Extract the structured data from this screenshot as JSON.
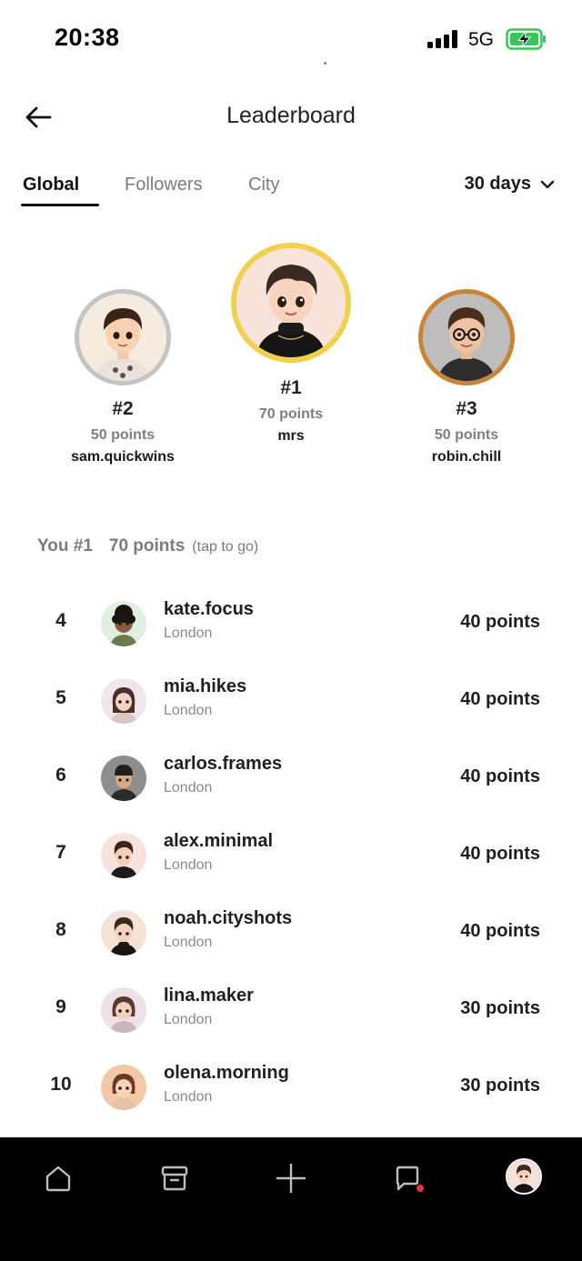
{
  "status_bar": {
    "time": "20:38",
    "network": "5G",
    "battery_state": "charging",
    "battery_color": "#34c759"
  },
  "header": {
    "title": "Leaderboard",
    "back_icon": "arrow-left-icon"
  },
  "tabs": [
    {
      "label": "Global",
      "active": true
    },
    {
      "label": "Followers",
      "active": false
    },
    {
      "label": "City",
      "active": false
    }
  ],
  "period": {
    "selected": "30 days",
    "icon": "chevron-down-icon"
  },
  "podium": {
    "first": {
      "rank": "#1",
      "points": "70 points",
      "username": "mrs",
      "ring_color": "#f3cf4f"
    },
    "second": {
      "rank": "#2",
      "points": "50 points",
      "username": "sam.quickwins",
      "ring_color": "#c4c4c4"
    },
    "third": {
      "rank": "#3",
      "points": "50 points",
      "username": "robin.chill",
      "ring_color": "#c98436"
    }
  },
  "you": {
    "rank": "You #1",
    "points": "70 points",
    "hint": "(tap to go)"
  },
  "leaderboard": [
    {
      "rank": "4",
      "username": "kate.focus",
      "city": "London",
      "points": "40 points"
    },
    {
      "rank": "5",
      "username": "mia.hikes",
      "city": "London",
      "points": "40 points"
    },
    {
      "rank": "6",
      "username": "carlos.frames",
      "city": "London",
      "points": "40 points"
    },
    {
      "rank": "7",
      "username": "alex.minimal",
      "city": "London",
      "points": "40 points"
    },
    {
      "rank": "8",
      "username": "noah.cityshots",
      "city": "London",
      "points": "40 points"
    },
    {
      "rank": "9",
      "username": "lina.maker",
      "city": "London",
      "points": "30 points"
    },
    {
      "rank": "10",
      "username": "olena.morning",
      "city": "London",
      "points": "30 points"
    }
  ],
  "bottom_nav": [
    {
      "name": "home-icon"
    },
    {
      "name": "archive-icon"
    },
    {
      "name": "plus-icon"
    },
    {
      "name": "chat-icon",
      "notification": true
    },
    {
      "name": "profile-avatar"
    }
  ],
  "colors": {
    "notification_dot": "#e53935",
    "muted_text": "#7a7f87"
  }
}
